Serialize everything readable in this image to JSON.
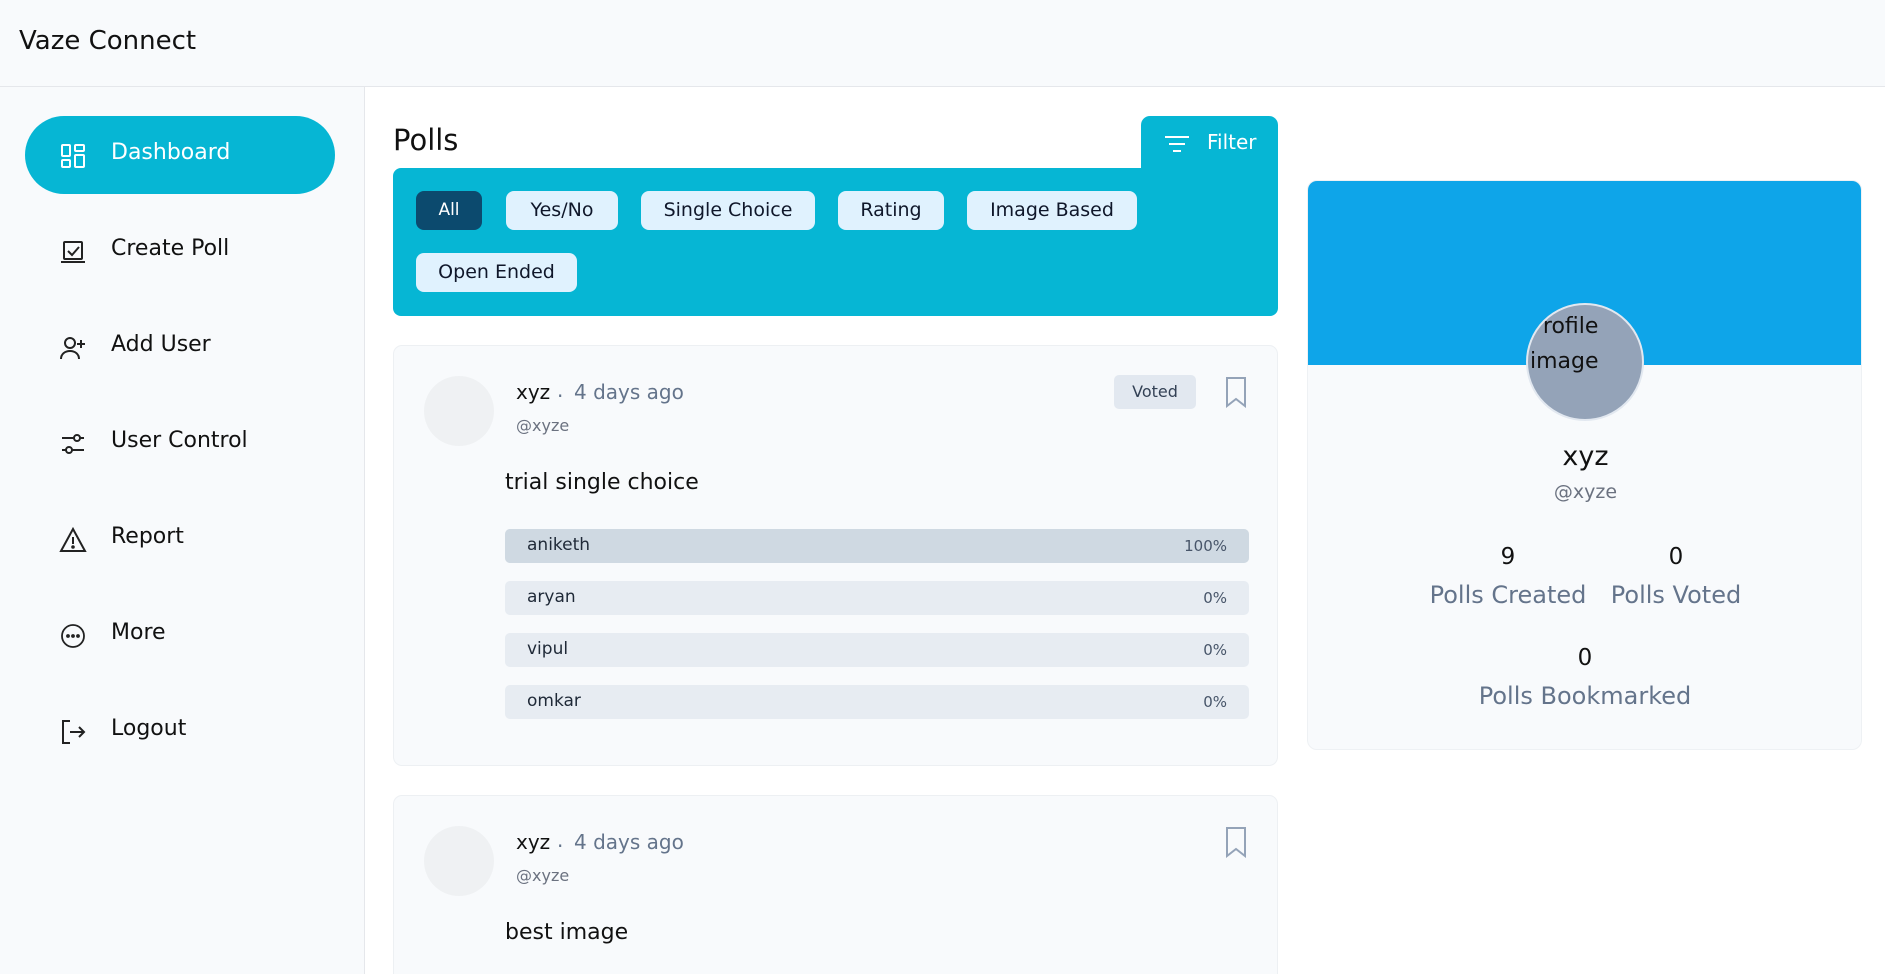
{
  "app": {
    "title": "Vaze Connect"
  },
  "sidebar": {
    "items": [
      {
        "label": "Dashboard",
        "icon": "dashboard-icon",
        "active": true
      },
      {
        "label": "Create Poll",
        "icon": "create-poll-icon"
      },
      {
        "label": "Add User",
        "icon": "add-user-icon"
      },
      {
        "label": "User Control",
        "icon": "sliders-icon"
      },
      {
        "label": "Report",
        "icon": "warning-icon"
      },
      {
        "label": "More",
        "icon": "more-icon"
      },
      {
        "label": "Logout",
        "icon": "logout-icon"
      }
    ]
  },
  "main": {
    "title": "Polls",
    "filter_label": "Filter",
    "chips": [
      "All",
      "Yes/No",
      "Single Choice",
      "Rating",
      "Image Based",
      "Open Ended"
    ],
    "active_chip": "All"
  },
  "polls": [
    {
      "author": "xyz",
      "separator": ".",
      "time": "4 days ago",
      "handle": "@xyze",
      "badge": "Voted",
      "question": "trial single choice",
      "options": [
        {
          "label": "aniketh",
          "percent": "100%",
          "value": 100
        },
        {
          "label": "aryan",
          "percent": "0%",
          "value": 0
        },
        {
          "label": "vipul",
          "percent": "0%",
          "value": 0
        },
        {
          "label": "omkar",
          "percent": "0%",
          "value": 0
        }
      ]
    },
    {
      "author": "xyz",
      "separator": ".",
      "time": "4 days ago",
      "handle": "@xyze",
      "question": "best image"
    }
  ],
  "profile": {
    "image_alt": "Profile image",
    "name": "xyz",
    "handle": "@xyze",
    "stats": {
      "created": {
        "value": "9",
        "label": "Polls Created"
      },
      "voted": {
        "value": "0",
        "label": "Polls Voted"
      },
      "bookmarked": {
        "value": "0",
        "label": "Polls Bookmarked"
      }
    }
  },
  "colors": {
    "accent": "#06b6d4",
    "banner": "#0ea5e9",
    "chip_active": "#0c4a6e",
    "chip_bg": "#e0f2fe"
  }
}
